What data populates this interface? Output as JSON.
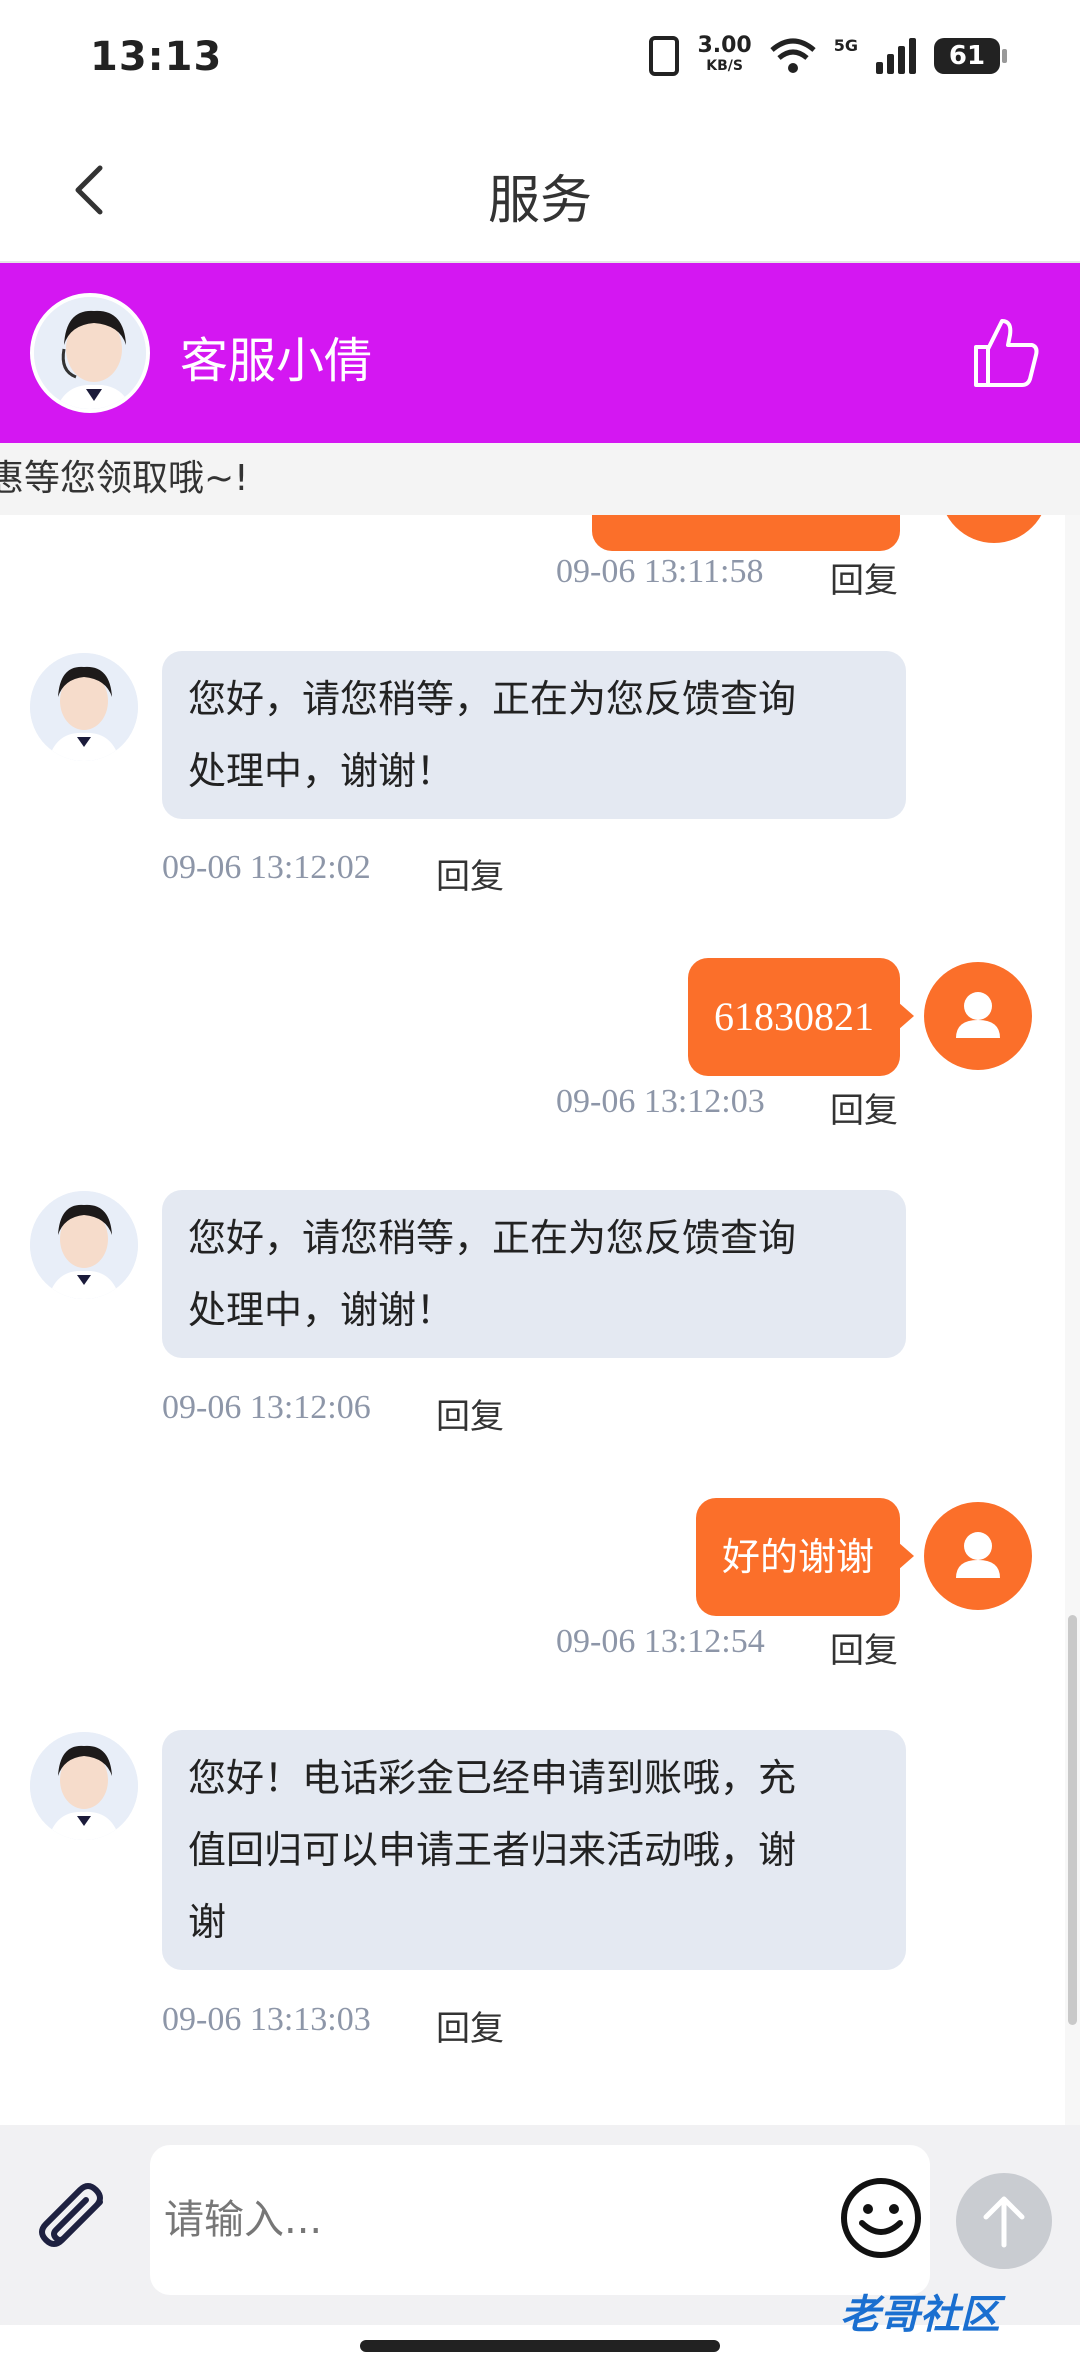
{
  "status": {
    "time": "13:13",
    "speed_value": "3.00",
    "speed_unit": "KB/S",
    "network": "5G",
    "battery": "61"
  },
  "nav": {
    "title": "服务"
  },
  "agent": {
    "name": "客服小倩"
  },
  "marquee": {
    "text": "惠等您领取哦~!"
  },
  "messages": [
    {
      "time": "09-06 13:11:58",
      "reply": "回复"
    },
    {
      "text_line1": "您好，请您稍等，正在为您反馈查询",
      "text_line2": "处理中，谢谢！",
      "time": "09-06 13:12:02",
      "reply": "回复"
    },
    {
      "text": "61830821",
      "time": "09-06 13:12:03",
      "reply": "回复"
    },
    {
      "text_line1": "您好，请您稍等，正在为您反馈查询",
      "text_line2": "处理中，谢谢！",
      "time": "09-06 13:12:06",
      "reply": "回复"
    },
    {
      "text": "好的谢谢",
      "time": "09-06 13:12:54",
      "reply": "回复"
    },
    {
      "text_line1": "您好！电话彩金已经申请到账哦，充",
      "text_line2": "值回归可以申请王者归来活动哦，谢",
      "text_line3": "谢",
      "time": "09-06 13:13:03",
      "reply": "回复"
    }
  ],
  "input": {
    "placeholder": "请输入..."
  },
  "watermark": "老哥社区",
  "colors": {
    "header": "#d417f2",
    "user_bubble": "#fb6f2a",
    "agent_bubble": "#e4e9f2"
  }
}
